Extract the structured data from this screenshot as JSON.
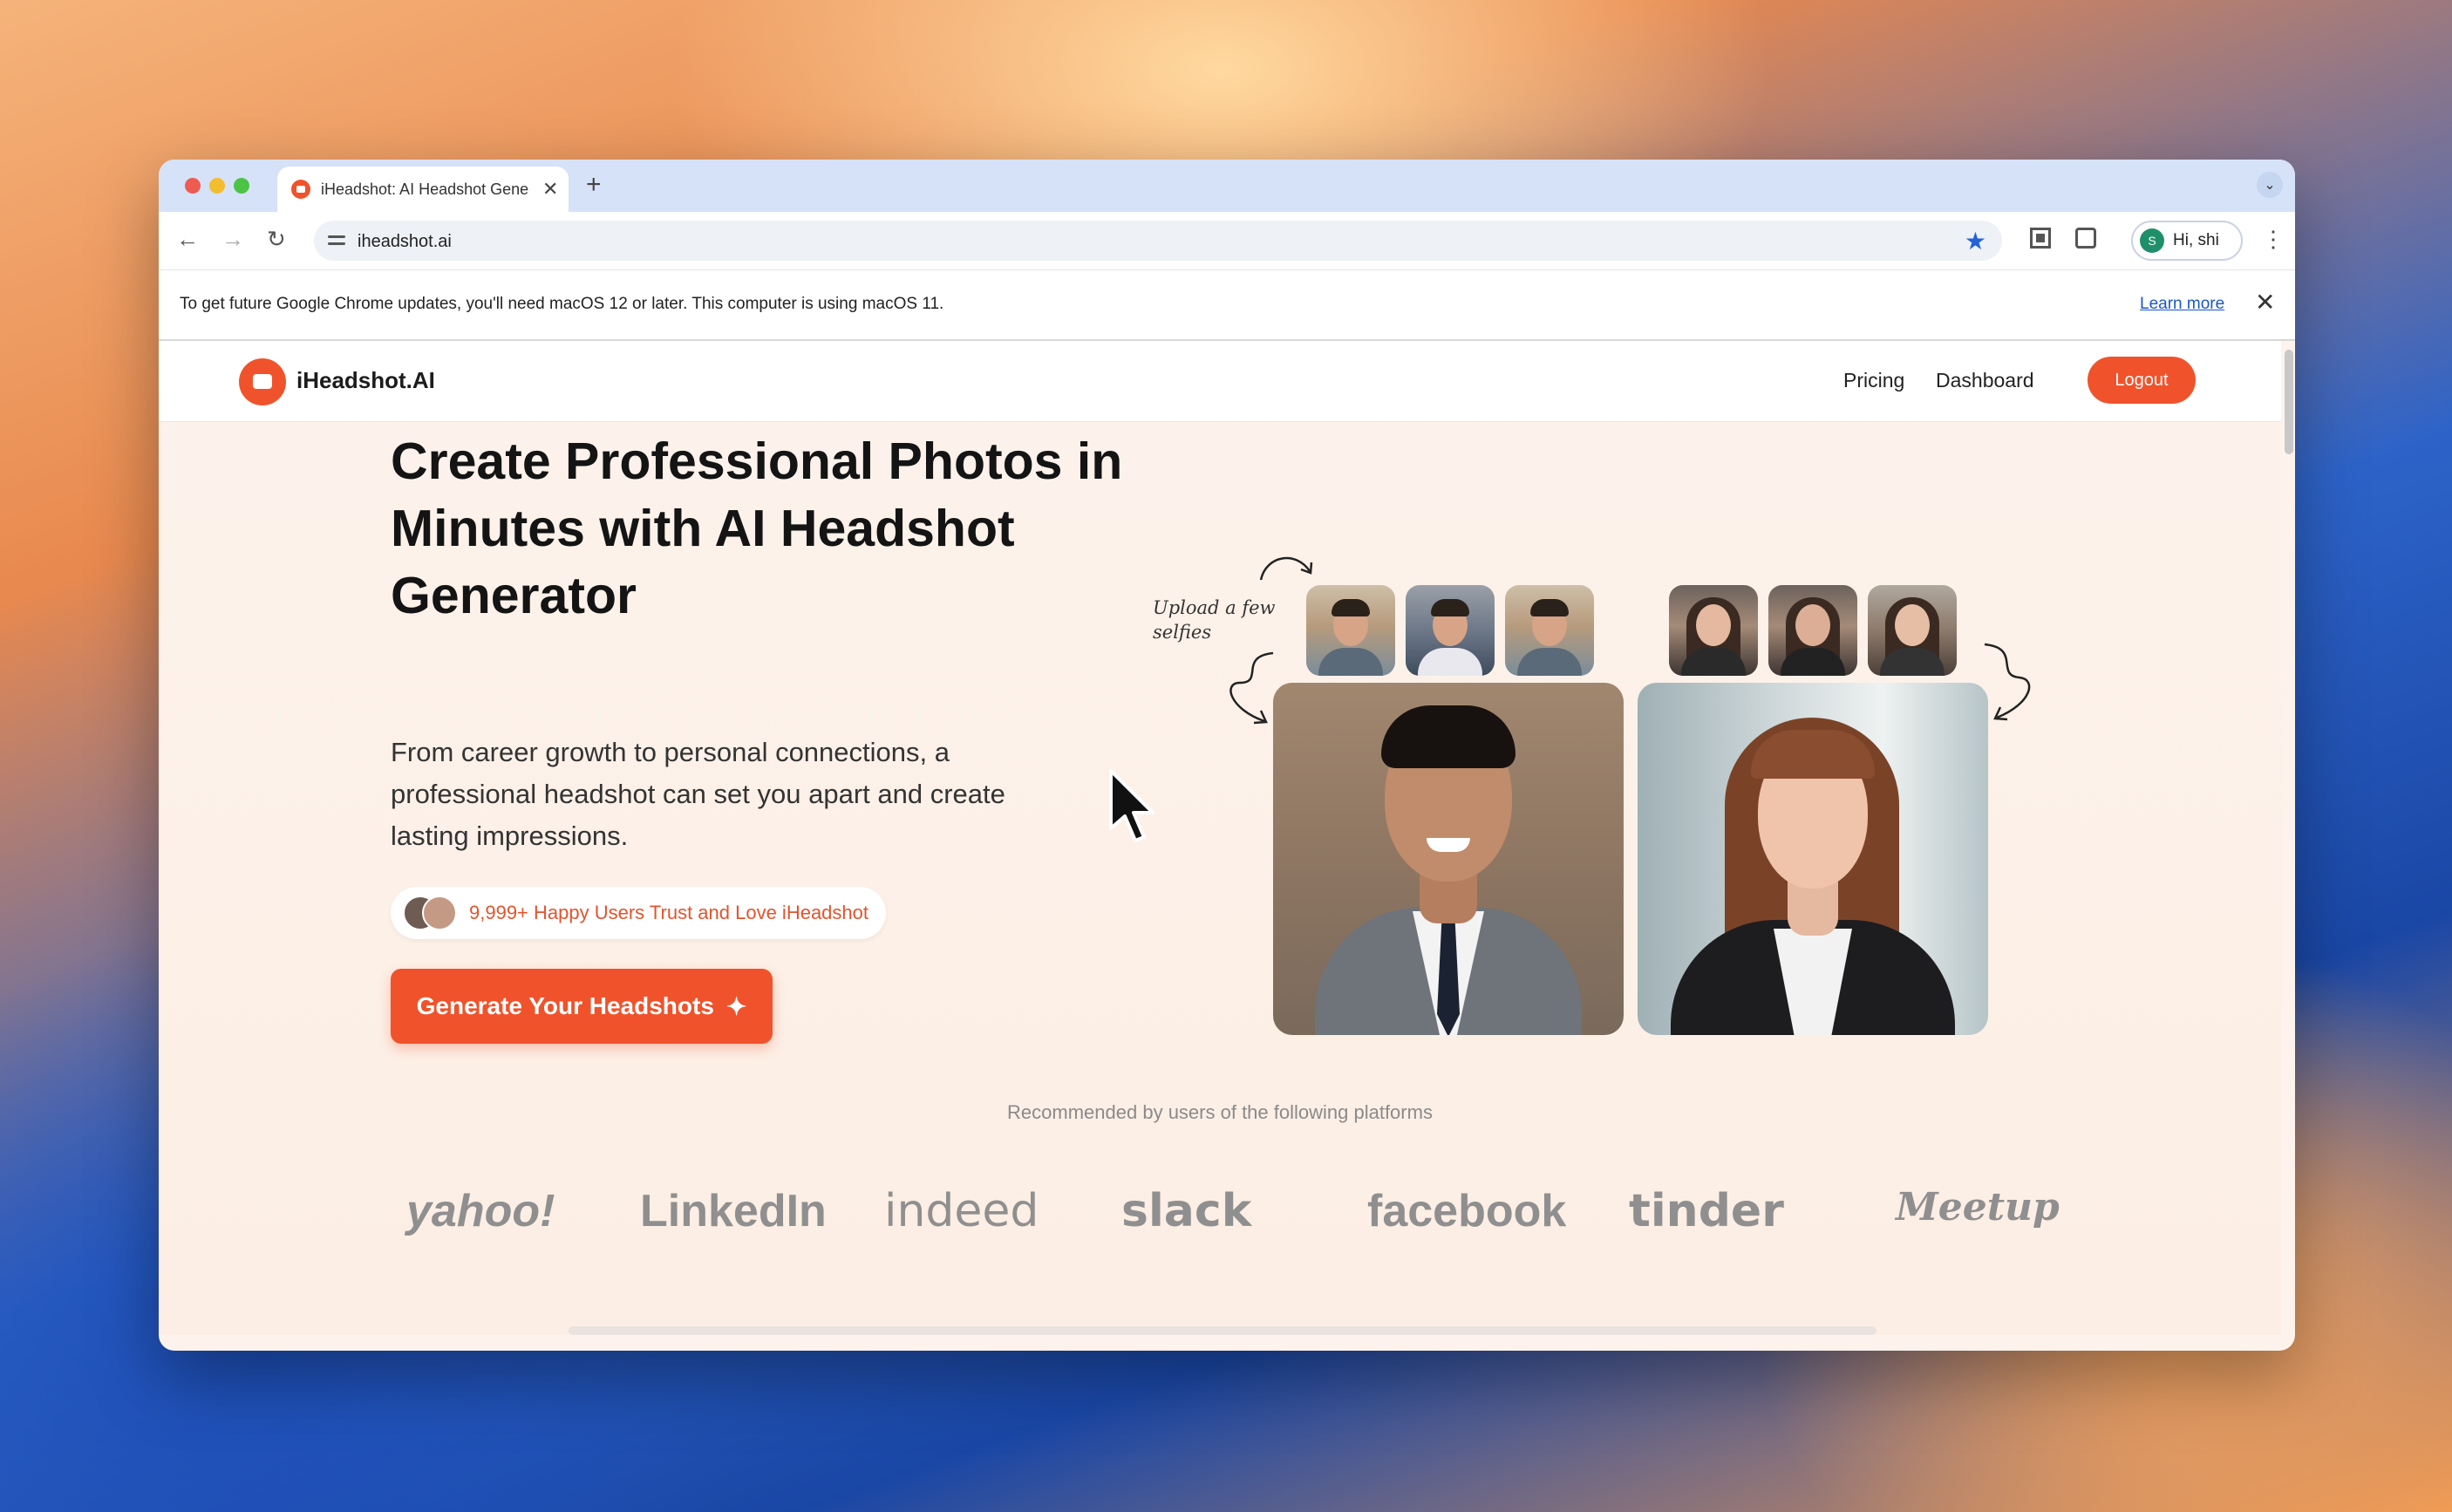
{
  "browser": {
    "tab_title": "iHeadshot: AI Headshot Gene",
    "tab_close": "✕",
    "new_tab": "+",
    "url": "iheadshot.ai",
    "profile_initial": "S",
    "profile_label": "Hi, shi"
  },
  "infobar": {
    "message": "To get future Google Chrome updates, you'll need macOS 12 or later. This computer is using macOS 11.",
    "learn_more": "Learn more",
    "close": "✕"
  },
  "site": {
    "logo_text": "iHeadshot.AI",
    "nav": {
      "pricing": "Pricing",
      "dashboard": "Dashboard",
      "logout": "Logout"
    }
  },
  "hero": {
    "title": "Create Professional Photos in Minutes with AI Headshot Generator",
    "subtitle": "From career growth to personal connections, a professional headshot can set you apart and create lasting impressions.",
    "trust_text": "9,999+ Happy Users Trust and Love iHeadshot",
    "cta_label": "Generate Your Headshots",
    "cta_icon": "✦",
    "upload_note": "Upload a few selfies"
  },
  "platforms": {
    "heading": "Recommended by users of the following platforms",
    "logos": [
      "yahoo!",
      "LinkedIn",
      "indeed",
      "slack",
      "facebook",
      "tinder",
      "Meetup"
    ]
  },
  "colors": {
    "accent": "#f0532b",
    "tab_bar": "#d6e2f8",
    "page_bg": "#fdf3ec"
  }
}
